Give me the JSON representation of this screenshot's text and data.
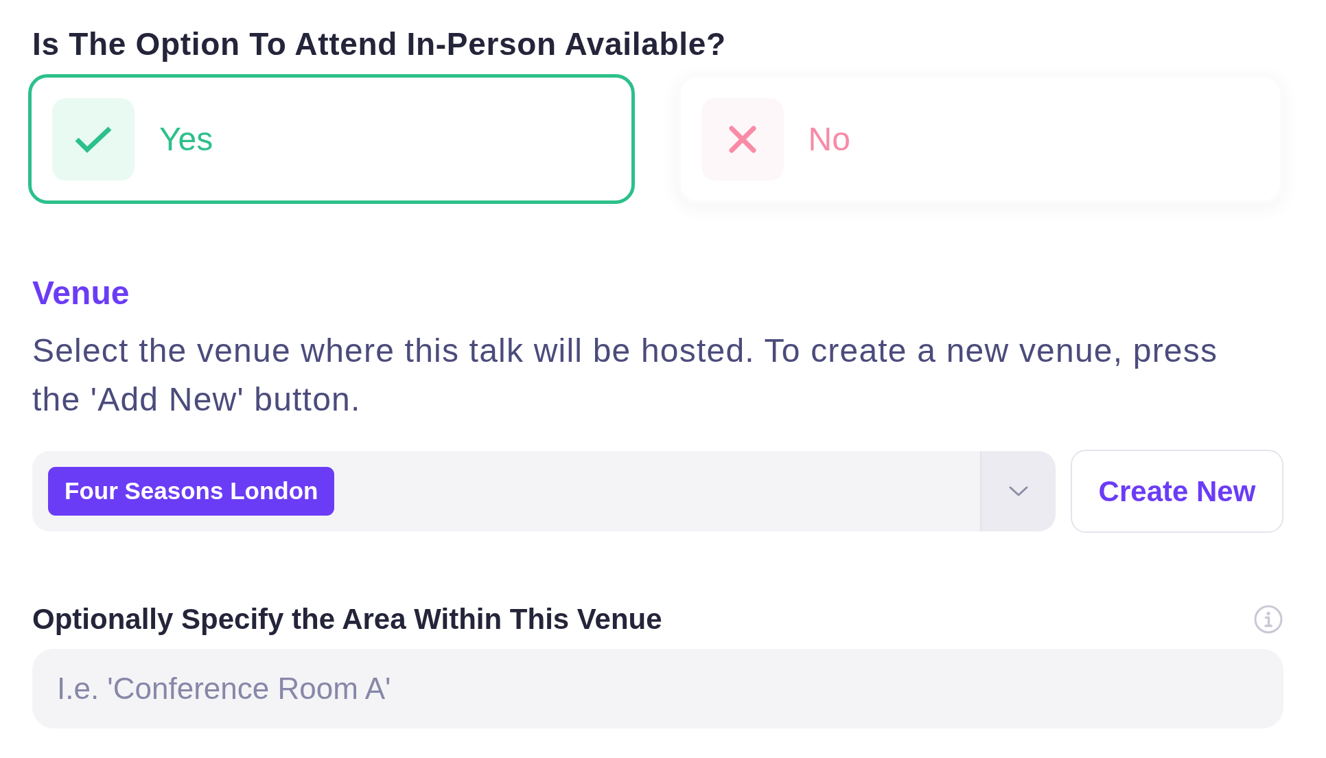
{
  "question": {
    "label": "Is The Option To Attend In-Person Available?",
    "options": [
      {
        "label": "Yes",
        "kind": "yes",
        "selected": true
      },
      {
        "label": "No",
        "kind": "no",
        "selected": false
      }
    ]
  },
  "venue": {
    "title": "Venue",
    "description": "Select the venue where this talk will be hosted. To create a new venue, press the 'Add New' button.",
    "select": {
      "value": "Four Seasons London"
    },
    "create_button": "Create New"
  },
  "area": {
    "label": "Optionally Specify the Area Within This Venue",
    "placeholder": "I.e. 'Conference Room A'"
  }
}
